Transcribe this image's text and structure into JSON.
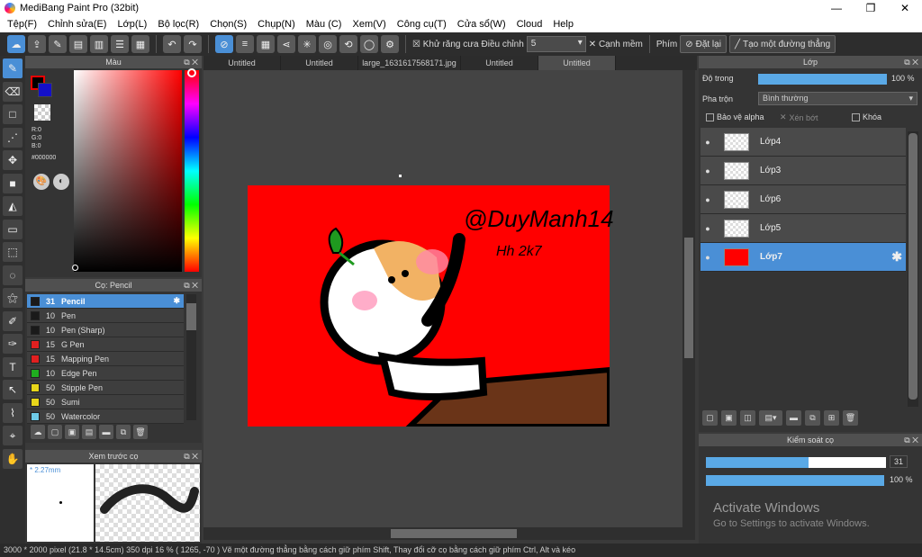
{
  "app": {
    "title": "MediBang Paint Pro (32bit)"
  },
  "window": {
    "minimize": "—",
    "maximize": "❐",
    "close": "✕"
  },
  "menu": [
    "Tệp(F)",
    "Chỉnh sửa(E)",
    "Lớp(L)",
    "Bộ lọc(R)",
    "Chọn(S)",
    "Chụp(N)",
    "Màu (C)",
    "Xem(V)",
    "Công cụ(T)",
    "Cửa sổ(W)",
    "Cloud",
    "Help"
  ],
  "toolbar": {
    "antialias_label": "Khử răng cưa",
    "adjust_label": "Điều chỉnh",
    "adjust_value": "5",
    "smooth_label": "Cạnh mềm",
    "keys_label": "Phím",
    "reset_label": "Đặt lại",
    "line_label": "Tạo một đường thẳng"
  },
  "panels": {
    "color": "Màu",
    "brush": "Cọ: Pencil",
    "preview": "Xem trước cọ",
    "layer": "Lớp",
    "control": "Kiểm soát cọ"
  },
  "color": {
    "r": "R:0",
    "g": "G:0",
    "b": "B:0",
    "hex": "#000000",
    "fg": "#000000",
    "bg": "#1410c9"
  },
  "brushes": [
    {
      "size": "31",
      "name": "Pencil",
      "color": "#1a1a1a"
    },
    {
      "size": "10",
      "name": "Pen",
      "color": "#1a1a1a"
    },
    {
      "size": "10",
      "name": "Pen (Sharp)",
      "color": "#1a1a1a"
    },
    {
      "size": "15",
      "name": "G Pen",
      "color": "#e02020"
    },
    {
      "size": "15",
      "name": "Mapping Pen",
      "color": "#e02020"
    },
    {
      "size": "10",
      "name": "Edge Pen",
      "color": "#1fae1f"
    },
    {
      "size": "50",
      "name": "Stipple Pen",
      "color": "#e8d61a"
    },
    {
      "size": "50",
      "name": "Sumi",
      "color": "#e8d61a"
    },
    {
      "size": "50",
      "name": "Watercolor",
      "color": "#6ecbe8"
    }
  ],
  "preview": {
    "size": "* 2.27mm"
  },
  "tabs": [
    "Untitled",
    "Untitled",
    "large_1631617568171.jpg",
    "Untitled",
    "Untitled"
  ],
  "artwork": {
    "text1": "@DuyManh14",
    "text2": "Hh 2k7"
  },
  "layer": {
    "opacity_label": "Độ trong",
    "opacity_value": "100 %",
    "blend_label": "Pha trộn",
    "blend_value": "Bình thường",
    "protect_alpha": "Bảo vệ alpha",
    "clip": "Xén bớt",
    "lock": "Khóa",
    "layers": [
      "Lớp4",
      "Lớp3",
      "Lớp6",
      "Lớp5",
      "Lớp7"
    ]
  },
  "control": {
    "size_value": "31",
    "size_fraction": 0.57,
    "opacity_value": "100 %",
    "opacity_fraction": 1.0
  },
  "watermark": {
    "line1": "Activate Windows",
    "line2": "Go to Settings to activate Windows."
  },
  "status": "3000 * 2000 pixel   (21.8 * 14.5cm)   350 dpi   16 %   ( 1265, -70 )   Vẽ một đường thẳng bằng cách giữ phím Shift, Thay đổi cỡ cọ bằng cách giữ phím Ctrl, Alt và kéo"
}
